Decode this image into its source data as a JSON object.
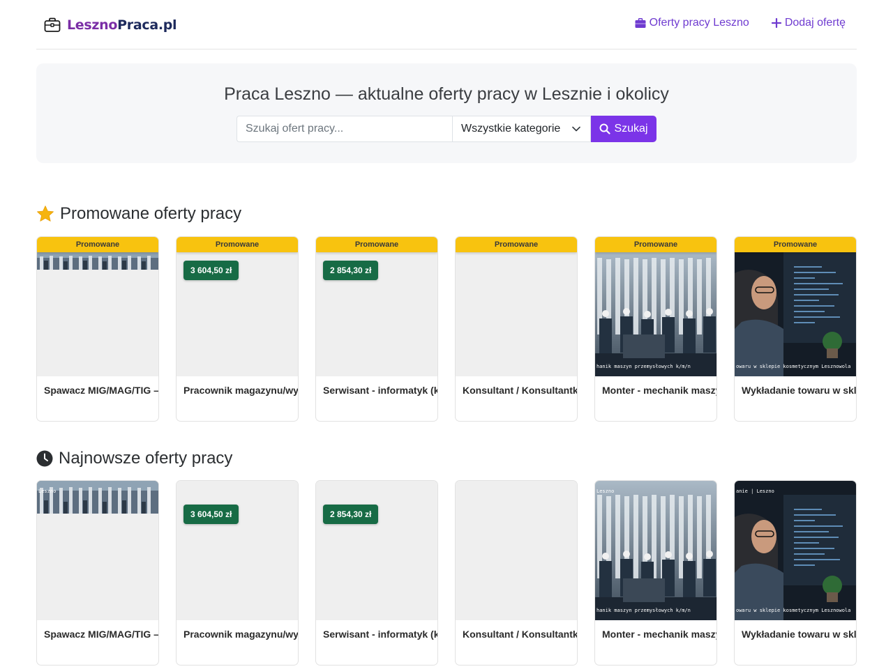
{
  "header": {
    "logo_part1": "Leszno",
    "logo_part2": "Praca.pl",
    "logo_icon": "briefcase-icon",
    "nav": [
      {
        "label": "Oferty pracy Leszno",
        "icon": "briefcase-icon"
      },
      {
        "label": "Dodaj ofertę",
        "icon": "plus-icon"
      }
    ]
  },
  "hero": {
    "title": "Praca Leszno — aktualne oferty pracy w Lesznie i okolicy",
    "search_placeholder": "Szukaj ofert pracy...",
    "search_value": "",
    "category_selected": "Wszystkie kategorie",
    "search_button": "Szukaj",
    "search_icon": "search-icon"
  },
  "promoted": {
    "title": "Promowane oferty pracy",
    "icon": "star-icon",
    "badge": "Promowane",
    "cards": [
      {
        "title": "Spawacz MIG/MAG/TIG –",
        "price": "",
        "image": "factory-strip"
      },
      {
        "title": "Pracownik magazynu/wy",
        "price": "3 604,50 zł",
        "image": "none"
      },
      {
        "title": "Serwisant - informatyk (k",
        "price": "2 854,30 zł",
        "image": "none"
      },
      {
        "title": "Konsultant / Konsultantk",
        "price": "",
        "image": "none"
      },
      {
        "title": "Monter - mechanik maszy",
        "price": "",
        "image": "factory",
        "caption": "hanik maszyn przemysłowych k/m/n"
      },
      {
        "title": "Wykładanie towaru w skl",
        "price": "",
        "image": "developer",
        "caption": "owaru w sklepie kosmetycznym Lesznowola"
      }
    ]
  },
  "newest": {
    "title": "Najnowsze oferty pracy",
    "icon": "clock-icon",
    "cards": [
      {
        "title": "Spawacz MIG/MAG/TIG –",
        "price": "",
        "image": "factory-strip",
        "corner": "Leszno"
      },
      {
        "title": "Pracownik magazynu/wy",
        "price": "3 604,50 zł",
        "image": "none"
      },
      {
        "title": "Serwisant - informatyk (k",
        "price": "2 854,30 zł",
        "image": "none"
      },
      {
        "title": "Konsultant / Konsultantk",
        "price": "",
        "image": "none"
      },
      {
        "title": "Monter - mechanik maszy",
        "price": "",
        "image": "factory",
        "caption": "hanik maszyn przemysłowych k/m/n",
        "corner": "Leszno"
      },
      {
        "title": "Wykładanie towaru w skl",
        "price": "",
        "image": "developer",
        "caption": "owaru w sklepie kosmetycznym Lesznowola",
        "corner": "anie  |  Leszno"
      }
    ]
  },
  "colors": {
    "accent": "#7b34e8",
    "nav_link": "#6f3bd0",
    "promo_badge": "#f8c30f",
    "price_badge": "#176b45"
  }
}
